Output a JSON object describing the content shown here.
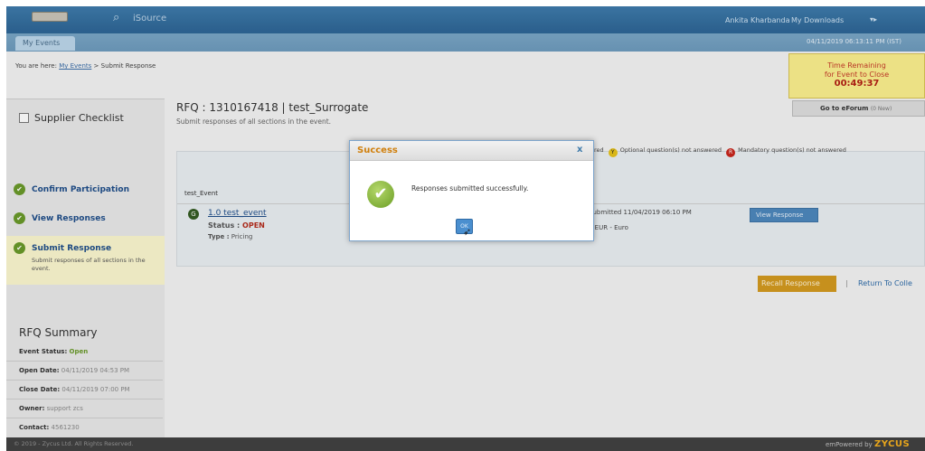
{
  "header": {
    "app_name": "iSource",
    "user": "Ankita Kharbanda",
    "downloads": "My Downloads",
    "flag": "▾▸"
  },
  "tabbar": {
    "tab": "My Events",
    "timestamp": "04/11/2019 06:13:11 PM (IST)"
  },
  "breadcrumb": {
    "prefix": "You are here:",
    "link": "My Events",
    "sep": ">",
    "current": "Submit Response"
  },
  "timer": {
    "line1": "Time Remaining",
    "line2": "for Event to Close",
    "clock": "00:49:37"
  },
  "forum": {
    "label": "Go to eForum",
    "count": "(0 New)"
  },
  "checklist": {
    "title": "Supplier Checklist",
    "items": [
      {
        "label": "Confirm Participation"
      },
      {
        "label": "View Responses"
      }
    ],
    "active": {
      "label": "Submit Response",
      "desc": "Submit responses of all sections in the event."
    }
  },
  "summary": {
    "title": "RFQ Summary",
    "status_label": "Event Status:",
    "status": "Open",
    "open_label": "Open Date:",
    "open": "04/11/2019 04:53 PM",
    "close_label": "Close Date:",
    "close": "04/11/2019 07:00 PM",
    "owner_label": "Owner:",
    "owner": "support zcs",
    "contact_label": "Contact:",
    "contact": "4561230"
  },
  "rfq": {
    "title": "RFQ : 1310167418 | test_Surrogate",
    "subtitle": "Submit responses of all sections in the event."
  },
  "legend": {
    "answered": "red",
    "optional": "Optional question(s) not answered",
    "mandatory": "Mandatory question(s) not answered"
  },
  "panel": {
    "event": "test_Event",
    "section": "1.0 test_event",
    "status_label": "Status :",
    "status": "OPEN",
    "type_label": "Type :",
    "type": "Pricing",
    "submitted": "Submitted 11/04/2019 06:10 PM",
    "currency": "0 EUR - Euro",
    "view_button": "View Response"
  },
  "actions": {
    "recall": "Recall Response",
    "separator": "|",
    "return": "Return To Colle"
  },
  "footer": {
    "copyright": "© 2019 - Zycus Ltd. All Rights Reserved.",
    "powered": "emPowered by",
    "brand": "ZYCUS"
  },
  "modal": {
    "title": "Success",
    "close": "x",
    "message": "Responses submitted successfully.",
    "ok": "OK"
  },
  "colors": {
    "header": "#3f7bab",
    "timer_bg": "#fbf08e",
    "success": "#d07f0c",
    "tick": "#6a9a2a",
    "recall": "#d39a1f"
  }
}
